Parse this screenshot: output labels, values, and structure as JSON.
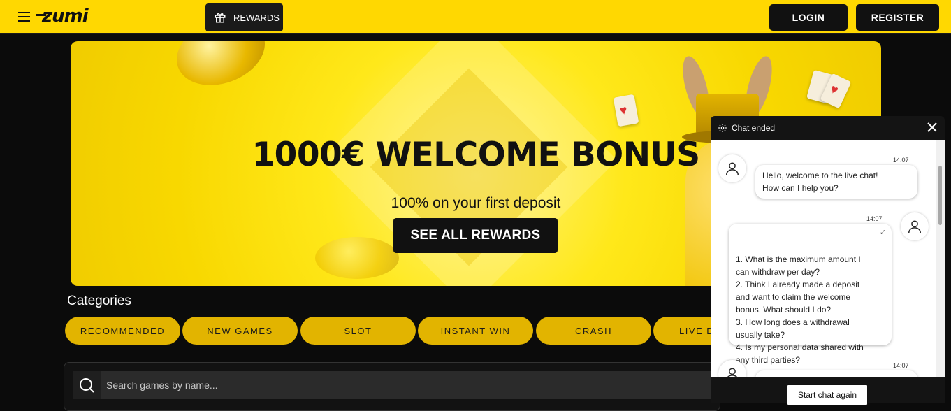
{
  "header": {
    "logo_text": "zumi",
    "rewards_label": "REWARDS",
    "login_label": "LOGIN",
    "register_label": "REGISTER",
    "brand_color": "#ffd801"
  },
  "banner": {
    "title": "1000€ WELCOME BONUS",
    "subtitle": "100% on your first deposit",
    "cta_label": "SEE ALL REWARDS"
  },
  "categories": {
    "title": "Categories",
    "items": [
      {
        "label": "RECOMMENDED"
      },
      {
        "label": "NEW GAMES"
      },
      {
        "label": "SLOT"
      },
      {
        "label": "INSTANT WIN"
      },
      {
        "label": "CRASH"
      },
      {
        "label": "LIVE D"
      }
    ],
    "pill_color": "#e2b400"
  },
  "search": {
    "placeholder": "Search games by name..."
  },
  "chat": {
    "status": "Chat ended",
    "messages": [
      {
        "from": "agent",
        "time": "14:07",
        "text": "Hello, welcome to the live chat!\nHow can I help you?"
      },
      {
        "from": "user",
        "time": "14:07",
        "text": "1. What is the maximum amount I\ncan withdraw per day?\n2. Think I already made a deposit\nand want to claim the welcome\nbonus. What should I do?\n3. How long does a withdrawal\nusually take?\n4. Is my personal data shared with\nany third parties?"
      },
      {
        "from": "agent",
        "time": "14:07",
        "text": ""
      }
    ],
    "restart_label": "Start chat again"
  }
}
